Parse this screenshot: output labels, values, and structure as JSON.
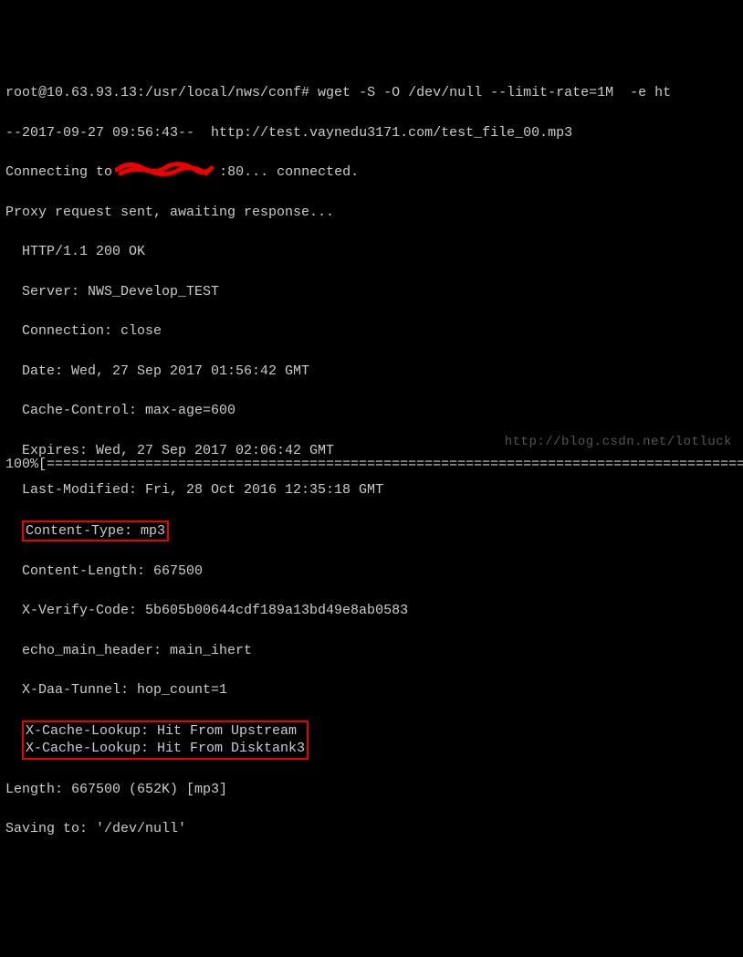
{
  "prompt": "root@10.63.93.13:/usr/local/nws/conf# wget -S -O /dev/null --limit-rate=1M  -e ht",
  "timestamp_line": "--2017-09-27 09:56:43--  http://test.vaynedu3171.com/test_file_00.mp3",
  "connecting_prefix": "Connecting to ",
  "connecting_suffix": ":80... connected.",
  "proxy_line": "Proxy request sent, awaiting response...",
  "headers": {
    "status": "HTTP/1.1 200 OK",
    "server": "Server: NWS_Develop_TEST",
    "connection": "Connection: close",
    "date": "Date: Wed, 27 Sep 2017 01:56:42 GMT",
    "cache_control": "Cache-Control: max-age=600",
    "expires": "Expires: Wed, 27 Sep 2017 02:06:42 GMT",
    "last_modified": "Last-Modified: Fri, 28 Oct 2016 12:35:18 GMT",
    "content_type": "Content-Type: mp3",
    "content_length": "Content-Length: 667500",
    "x_verify": "X-Verify-Code: 5b605b00644cdf189a13bd49e8ab0583",
    "echo_main": "echo_main_header: main_ihert",
    "x_daa": "X-Daa-Tunnel: hop_count=1",
    "x_cache1": "X-Cache-Lookup: Hit From Upstream",
    "x_cache2": "X-Cache-Lookup: Hit From Disktank3"
  },
  "length_line": "Length: 667500 (652K) [mp3]",
  "saving_line": "Saving to: '/dev/null'",
  "progress": "100%[======================================================================================",
  "watermark": "http://blog.csdn.net/lotluck"
}
